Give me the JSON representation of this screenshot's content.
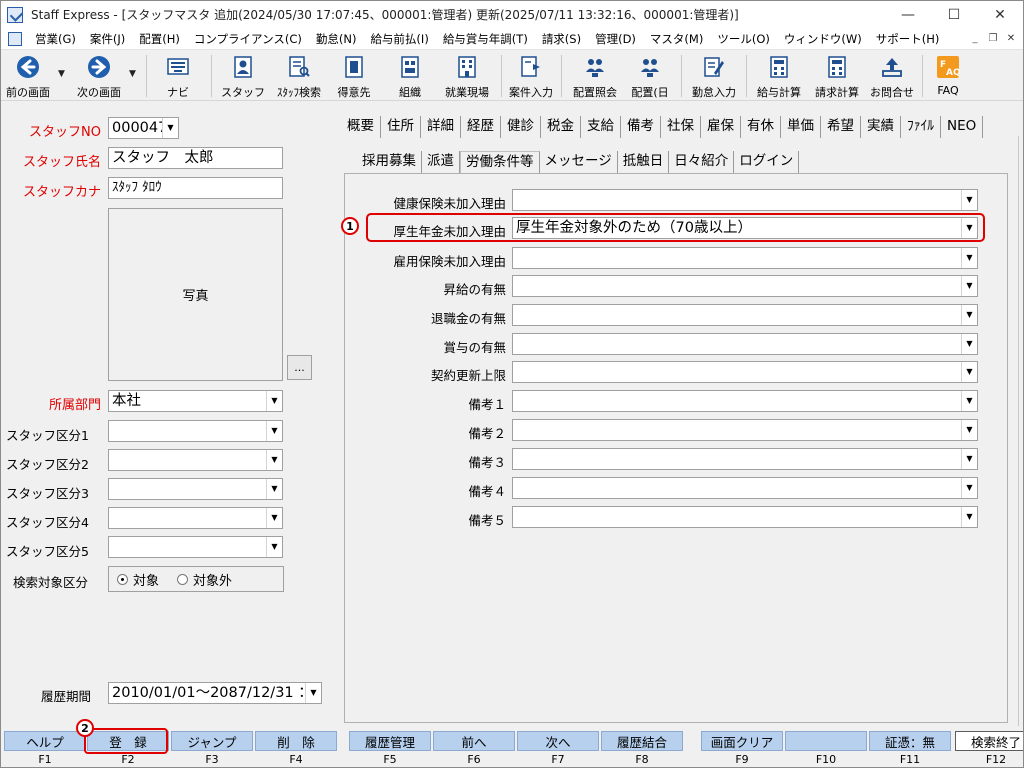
{
  "window": {
    "title": "Staff Express - [スタッフマスタ  追加(2024/05/30 17:07:45、000001:管理者)  更新(2025/07/11 13:32:16、000001:管理者)]",
    "controls": {
      "minimize": "—",
      "maximize": "☐",
      "close": "✕"
    }
  },
  "menu": {
    "items": [
      "営業(G)",
      "案件(J)",
      "配置(H)",
      "コンプライアンス(C)",
      "勤怠(N)",
      "給与前払(I)",
      "給与賞与年調(T)",
      "請求(S)",
      "管理(D)",
      "マスタ(M)",
      "ツール(O)",
      "ウィンドウ(W)",
      "サポート(H)"
    ],
    "mdi": {
      "minimize": "_",
      "restore": "❐",
      "close": "✕"
    }
  },
  "toolbar": {
    "prev": "前の画面",
    "next": "次の画面",
    "navi": "ナビ",
    "staff": "スタッフ",
    "staff_search": "ｽﾀｯﾌ検索",
    "client": "得意先",
    "org": "組織",
    "site": "就業現場",
    "job_entry": "案件入力",
    "assign_ref": "配置照会",
    "assign_day": "配置(日",
    "attendance": "勤怠入力",
    "payroll": "給与計算",
    "billing": "請求計算",
    "contact": "お問合せ",
    "faq": "FAQ"
  },
  "left": {
    "staff_no_label": "スタッフNO",
    "staff_no": "000047",
    "staff_name_label": "スタッフ氏名",
    "staff_name": "スタッフ　太郎",
    "staff_kana_label": "スタッフカナ",
    "staff_kana": "ｽﾀｯﾌ ﾀﾛｳ",
    "photo_label": "写真",
    "ellipsis": "...",
    "dept_label": "所属部門",
    "dept": "本社",
    "class1_label": "スタッフ区分1",
    "class2_label": "スタッフ区分2",
    "class3_label": "スタッフ区分3",
    "class4_label": "スタッフ区分4",
    "class5_label": "スタッフ区分5",
    "search_target_label": "検索対象区分",
    "radio_target": "対象",
    "radio_nontarget": "対象外",
    "history_label": "履歴期間",
    "history": "2010/01/01～2087/12/31 ："
  },
  "tabs_main": [
    "概要",
    "住所",
    "詳細",
    "経歴",
    "健診",
    "税金",
    "支給",
    "備考",
    "社保",
    "雇保",
    "有休",
    "単価",
    "希望",
    "実績",
    "ﾌｧｲﾙ",
    "NEO"
  ],
  "tabs_sub": [
    "採用募集",
    "派遣",
    "労働条件等",
    "メッセージ",
    "抵触日",
    "日々紹介",
    "ログイン"
  ],
  "form": {
    "rows": [
      {
        "label": "健康保険未加入理由",
        "value": ""
      },
      {
        "label": "厚生年金未加入理由",
        "value": "厚生年金対象外のため（70歳以上）"
      },
      {
        "label": "雇用保険未加入理由",
        "value": ""
      },
      {
        "label": "昇給の有無",
        "value": ""
      },
      {
        "label": "退職金の有無",
        "value": ""
      },
      {
        "label": "賞与の有無",
        "value": ""
      },
      {
        "label": "契約更新上限",
        "value": ""
      },
      {
        "label": "備考１",
        "value": ""
      },
      {
        "label": "備考２",
        "value": ""
      },
      {
        "label": "備考３",
        "value": ""
      },
      {
        "label": "備考４",
        "value": ""
      },
      {
        "label": "備考５",
        "value": ""
      }
    ]
  },
  "badges": {
    "one": "1",
    "two": "2"
  },
  "fkeys": [
    {
      "label": "ヘルプ",
      "key": "F1"
    },
    {
      "label": "登　録",
      "key": "F2"
    },
    {
      "label": "ジャンプ",
      "key": "F3"
    },
    {
      "label": "削　除",
      "key": "F4"
    },
    {
      "label": "履歴管理",
      "key": "F5"
    },
    {
      "label": "前へ",
      "key": "F6"
    },
    {
      "label": "次へ",
      "key": "F7"
    },
    {
      "label": "履歴結合",
      "key": "F8"
    },
    {
      "label": "画面クリア",
      "key": "F9"
    },
    {
      "label": "",
      "key": "F10"
    },
    {
      "label": "証憑：無",
      "key": "F11"
    },
    {
      "label": "検索終了",
      "key": "F12"
    }
  ],
  "colors": {
    "accent_red": "#e00000",
    "fkey_blue": "#b6d0ee",
    "nav_blue": "#1f5fae"
  }
}
